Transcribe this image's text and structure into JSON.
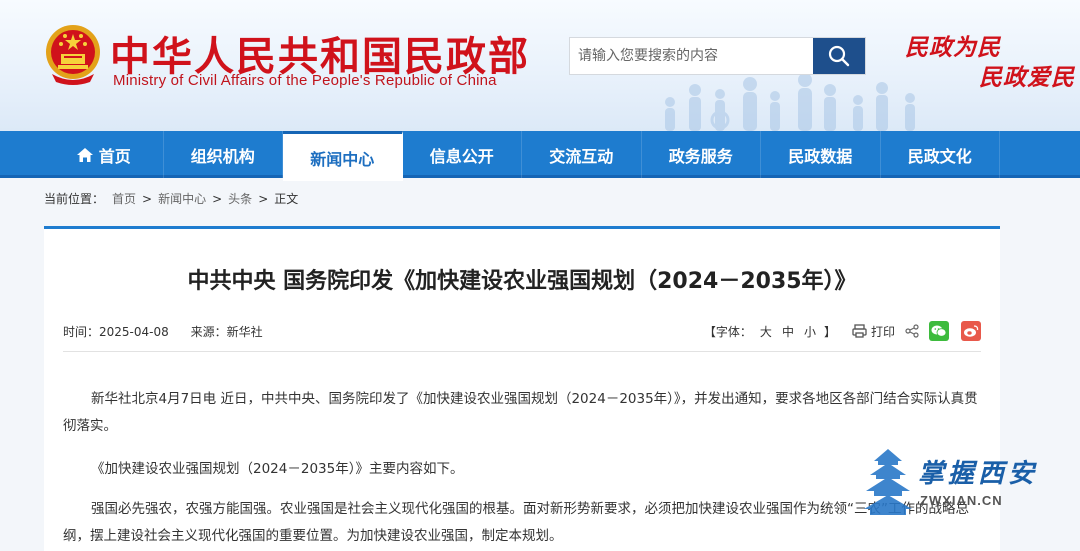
{
  "header": {
    "title": "中华人民共和国民政部",
    "subtitle": "Ministry of Civil Affairs of the People's Republic of China",
    "search_placeholder": "请输入您要搜索的内容",
    "slogan_line1": "民政为民",
    "slogan_line2": "民政爱民",
    "emblem_icon": "national-emblem-icon",
    "search_icon": "search-icon"
  },
  "nav": {
    "items": [
      {
        "label": "首页",
        "icon": "home-icon"
      },
      {
        "label": "组织机构"
      },
      {
        "label": "新闻中心",
        "active": true
      },
      {
        "label": "信息公开"
      },
      {
        "label": "交流互动"
      },
      {
        "label": "政务服务"
      },
      {
        "label": "民政数据"
      },
      {
        "label": "民政文化"
      }
    ]
  },
  "breadcrumb": {
    "prefix": "当前位置：",
    "home": "首页",
    "news": "新闻中心",
    "headline": "头条",
    "current": "正文",
    "sep": ">"
  },
  "article": {
    "title": "中共中央  国务院印发《加快建设农业强国规划（2024－2035年）》",
    "time_label": "时间：2025-04-08",
    "source_label": "来源：新华社",
    "font_label_open": "【字体：",
    "font_large": "大",
    "font_medium": "中",
    "font_small": "小",
    "font_label_close": "】",
    "print_label": "打印",
    "paragraphs": [
      "新华社北京4月7日电  近日，中共中央、国务院印发了《加快建设农业强国规划（2024－2035年）》，并发出通知，要求各地区各部门结合实际认真贯彻落实。",
      "《加快建设农业强国规划（2024－2035年）》主要内容如下。",
      "强国必先强农，农强方能国强。农业强国是社会主义现代化强国的根基。面对新形势新要求，必须把加快建设农业强国作为统领“三农”工作的战略总纲，摆上建设社会主义现代化强国的重要位置。为加快建设农业强国，制定本规划。"
    ]
  },
  "watermark": {
    "text": "掌握西安",
    "domain": "ZWXIAN.CN"
  },
  "colors": {
    "brand_red": "#d0121b",
    "nav_blue": "#1e7ccf",
    "search_btn": "#1e4f8c",
    "wechat": "#3dbb3d",
    "weibo": "#e8594b"
  }
}
